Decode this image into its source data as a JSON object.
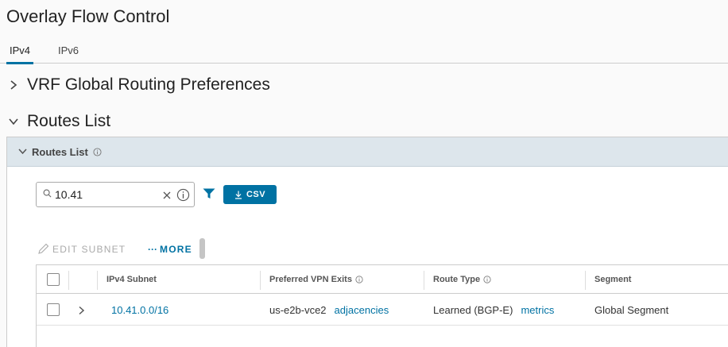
{
  "page": {
    "title": "Overlay Flow Control"
  },
  "tabs": [
    {
      "label": "IPv4",
      "active": true
    },
    {
      "label": "IPv6",
      "active": false
    }
  ],
  "sections": {
    "vrf": {
      "label": "VRF Global Routing Preferences",
      "expanded": false
    },
    "routes": {
      "label": "Routes List",
      "expanded": true
    }
  },
  "panel": {
    "title": "Routes List"
  },
  "search": {
    "value": "10.41"
  },
  "toolbar": {
    "csv_label": "CSV"
  },
  "actions": {
    "edit_subnet": "EDIT SUBNET",
    "more": "MORE",
    "more_dots": "···"
  },
  "table": {
    "columns": [
      "IPv4 Subnet",
      "Preferred VPN Exits",
      "Route Type",
      "Segment"
    ],
    "rows": [
      {
        "subnet": "10.41.0.0/16",
        "vpn_exit": "us-e2b-vce2",
        "vpn_exit_link": "adjacencies",
        "route_type": "Learned (BGP-E)",
        "route_type_link": "metrics",
        "segment": "Global Segment"
      }
    ]
  },
  "colors": {
    "accent": "#0072a3",
    "header_bg": "#dde6ec"
  }
}
